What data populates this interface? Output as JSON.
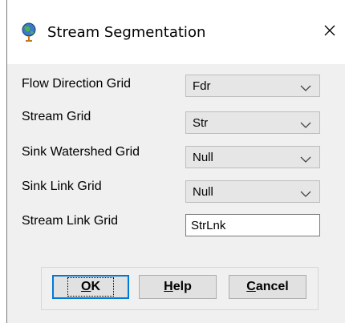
{
  "window": {
    "title": "Stream Segmentation",
    "icon": "globe-pin-icon",
    "close_glyph": "✕"
  },
  "form": {
    "flow_direction": {
      "label": "Flow Direction Grid",
      "value": "Fdr"
    },
    "stream": {
      "label": "Stream Grid",
      "value": "Str"
    },
    "sink_watershed": {
      "label": "Sink Watershed Grid",
      "value": "Null"
    },
    "sink_link": {
      "label": "Sink Link Grid",
      "value": "Null"
    },
    "stream_link": {
      "label": "Stream Link Grid",
      "value": "StrLnk"
    }
  },
  "buttons": {
    "ok": {
      "mnemonic": "O",
      "rest": "K"
    },
    "help": {
      "mnemonic": "H",
      "rest": "elp"
    },
    "cancel": {
      "mnemonic": "C",
      "rest": "ancel"
    }
  },
  "colors": {
    "dialog_bg": "#f0f0f0",
    "titlebar_bg": "#ffffff",
    "combo_bg": "#e6e6e6",
    "default_button_border": "#0078d7"
  }
}
